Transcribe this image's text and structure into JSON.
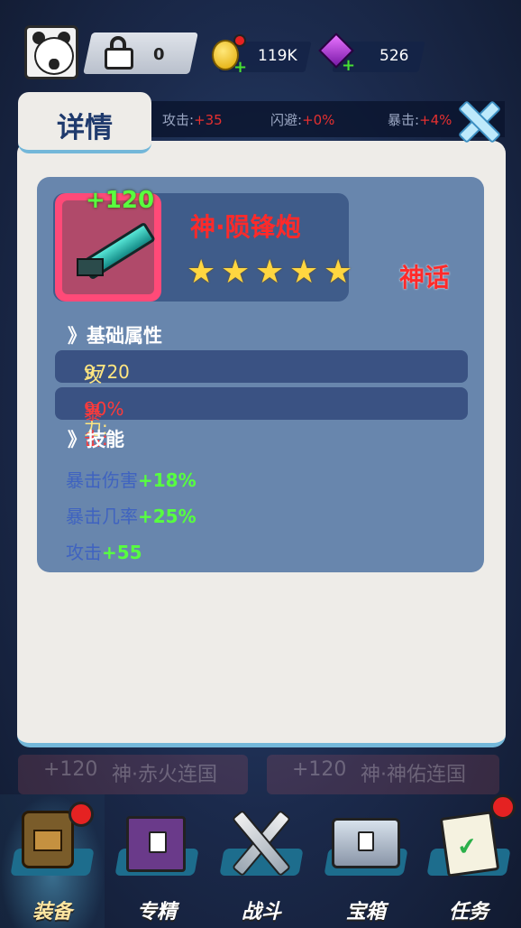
{
  "topbar": {
    "lock_count": "0",
    "coins": "119K",
    "gems": "526"
  },
  "stats": [
    {
      "label": "攻击:",
      "value": "+35"
    },
    {
      "label": "闪避:",
      "value": "+0%"
    },
    {
      "label": "暴击:",
      "value": "+4%"
    }
  ],
  "dialog": {
    "title": "详情",
    "item": {
      "level": "+120",
      "name": "神·陨锋炮",
      "stars": 5,
      "rarity": "神话"
    },
    "basic_title": "》基础属性",
    "attributes": [
      {
        "label": "攻击力:",
        "value": "9720",
        "color": "#ffe680"
      },
      {
        "label": "暴击:",
        "value": "90%",
        "color": "#ff3a3a"
      }
    ],
    "skills_title": "》技能",
    "skills": [
      {
        "label": "暴击伤害",
        "value": "+18%"
      },
      {
        "label": "暴击几率",
        "value": "+25%"
      },
      {
        "label": "攻击",
        "value": "+55"
      }
    ]
  },
  "background_rows": [
    {
      "level": "+120",
      "name": "神·赤火连国"
    },
    {
      "level": "+120",
      "name": "神·神佑连国"
    }
  ],
  "nav": [
    {
      "label": "装备",
      "active": true,
      "badge": true,
      "icon": "backpack-icon"
    },
    {
      "label": "专精",
      "active": false,
      "badge": false,
      "icon": "book-icon"
    },
    {
      "label": "战斗",
      "active": false,
      "badge": false,
      "icon": "crossed-swords-icon"
    },
    {
      "label": "宝箱",
      "active": false,
      "badge": false,
      "icon": "chest-icon"
    },
    {
      "label": "任务",
      "active": false,
      "badge": true,
      "icon": "quest-scroll-icon"
    }
  ]
}
